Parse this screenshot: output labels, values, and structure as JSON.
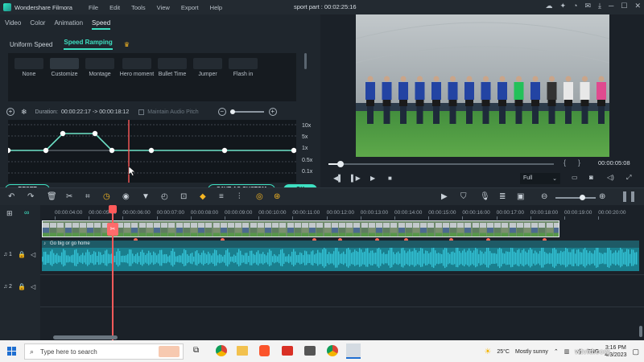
{
  "titlebar": {
    "app_name": "Wondershare Filmora",
    "menu": [
      "File",
      "Edit",
      "Tools",
      "View",
      "Export",
      "Help"
    ],
    "document": "sport part : 00:02:25:16"
  },
  "panel": {
    "tabs": [
      "Video",
      "Color",
      "Animation",
      "Speed"
    ],
    "active_tab": "Speed",
    "subtabs": [
      "Uniform Speed",
      "Speed Ramping"
    ],
    "active_subtab": "Speed Ramping",
    "presets": [
      "None",
      "Customize",
      "Montage",
      "Hero moment",
      "Bullet Time",
      "Jumper",
      "Flash in"
    ],
    "selected_preset": "Customize",
    "duration_label": "Duration:",
    "duration_value": "00:00:22:17 -> 00:00:18:12",
    "maintain_pitch": "Maintain Audio Pitch",
    "speed_labels": [
      "10x",
      "5x",
      "1x",
      "0.5x",
      "0.1x"
    ],
    "reset_label": "RESET",
    "save_custom_label": "SAVE AS CUSTOM",
    "ok_label": "OK"
  },
  "preview": {
    "timecode": "00:00:05:08",
    "quality": "Full",
    "brace_left": "{",
    "brace_right": "}"
  },
  "timeline": {
    "ruler_labels": [
      "00:00:04:00",
      "00:00:05:00",
      "00:00:06:00",
      "00:00:07:00",
      "00:00:08:00",
      "00:00:09:00",
      "00:00:10:00",
      "00:00:11:00",
      "00:00:12:00",
      "00:00:13:00",
      "00:00:14:00",
      "00:00:15:00",
      "00:00:16:00",
      "00:00:17:00",
      "00:00:18:00",
      "00:00:19:00",
      "00:00:20:00"
    ],
    "audio_clip_name": "Go big or go home",
    "track_labels": [
      "1",
      "2"
    ]
  },
  "taskbar": {
    "search_placeholder": "Type here to search",
    "weather_temp": "25°C",
    "weather_desc": "Mostly sunny",
    "language": "ENG",
    "time": "3:16 PM",
    "date": "4/3/2023"
  },
  "colors": {
    "accent": "#3ee0c2",
    "playhead": "#ff5a5a",
    "audio": "#1a9bb0"
  }
}
